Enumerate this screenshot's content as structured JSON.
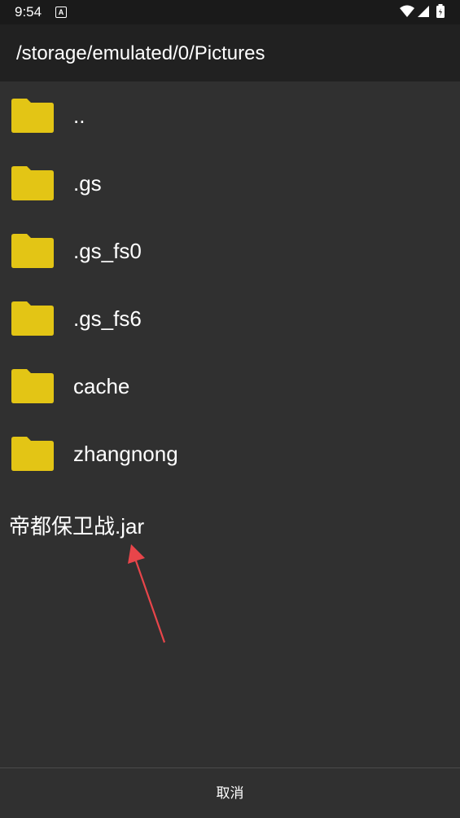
{
  "status_bar": {
    "time": "9:54",
    "notification_icon": "a-icon"
  },
  "header": {
    "path": "/storage/emulated/0/Pictures"
  },
  "folders": [
    {
      "name": ".."
    },
    {
      "name": ".gs"
    },
    {
      "name": ".gs_fs0"
    },
    {
      "name": ".gs_fs6"
    },
    {
      "name": "cache"
    },
    {
      "name": "zhangnong"
    }
  ],
  "files": [
    {
      "name": "帝都保卫战.jar"
    }
  ],
  "footer": {
    "cancel_label": "取消"
  },
  "colors": {
    "folder": "#e3c515",
    "background": "#303030",
    "header": "#212121",
    "annotation": "#e8454a"
  }
}
